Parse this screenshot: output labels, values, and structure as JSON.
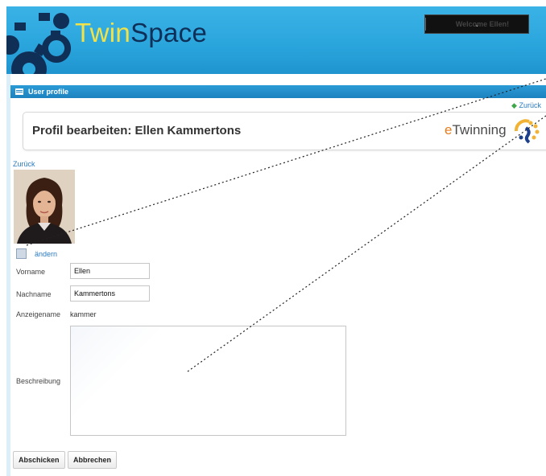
{
  "header": {
    "brand_twin": "Twin",
    "brand_space": "Space",
    "welcome_label": "Welcome Ellen!",
    "menu_chevron": "⌄"
  },
  "panel": {
    "title": "User profile",
    "top_back_link": "Zurück"
  },
  "profile": {
    "heading": "Profil bearbeiten: Ellen Kammertons",
    "etwinning_e": "e",
    "etwinning_rest": "Twinning",
    "back_link": "Zurück",
    "change_photo_link": "ändern"
  },
  "form": {
    "vorname_label": "Vorname",
    "vorname_value": "Ellen",
    "nachname_label": "Nachname",
    "nachname_value": "Kammertons",
    "anzeigename_label": "Anzeigename",
    "anzeigename_value": "kammer",
    "beschreibung_label": "Beschreibung",
    "beschreibung_value": "",
    "submit_label": "Abschicken",
    "cancel_label": "Abbrechen"
  },
  "colors": {
    "header_blue": "#2ba6dd",
    "brand_yellow": "#f2e24a",
    "brand_navy": "#0e2f57",
    "link_blue": "#2a7bbf"
  }
}
